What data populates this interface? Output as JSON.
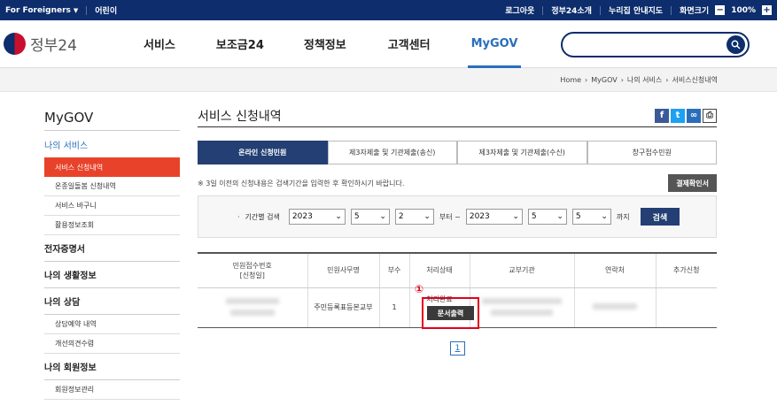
{
  "topbar": {
    "for_foreigners": "For Foreigners",
    "kids": "어린이",
    "logout": "로그아웃",
    "about": "정부24소개",
    "sitemap": "누리집 안내지도",
    "screen_size": "화면크기",
    "zoom_level": "100%"
  },
  "header": {
    "logo_text": "정부24",
    "nav": [
      "서비스",
      "보조금24",
      "정책정보",
      "고객센터",
      "MyGOV"
    ],
    "search_placeholder": ""
  },
  "breadcrumb": [
    "Home",
    "MyGOV",
    "나의 서비스",
    "서비스신청내역"
  ],
  "sidebar": {
    "title": "MyGOV",
    "my_services": "나의 서비스",
    "sub_items": [
      "서비스 신청내역",
      "온종일돌봄 신청내역",
      "서비스 바구니",
      "활용정보조회"
    ],
    "sections": [
      "전자증명서",
      "나의 생활정보",
      "나의 상담"
    ],
    "consult_items": [
      "상담예약 내역",
      "개선의견수렴"
    ],
    "member_section": "나의 회원정보",
    "member_items": [
      "회원정보관리"
    ]
  },
  "main": {
    "title": "서비스 신청내역",
    "tabs": [
      "온라인 신청민원",
      "제3자제출 및 기관제출(송신)",
      "제3자제출 및 기관제출(수신)",
      "창구접수민원"
    ],
    "notice": "※ 3일 이전의 신청내용은 검색기간을 입력한 후 확인하시기 바랍니다.",
    "receipt_button": "결제확인서",
    "filter": {
      "label": "기간별 검색",
      "from_year": "2023",
      "from_month": "5",
      "from_day": "2",
      "from_text": "부터 ~",
      "to_year": "2023",
      "to_month": "5",
      "to_day": "5",
      "to_text": "까지",
      "search_button": "검색"
    },
    "table": {
      "headers": [
        "민원접수번호\n[신청일]",
        "민원사무명",
        "부수",
        "처리상태",
        "교부기관",
        "연락처",
        "추가신청"
      ],
      "rows": [
        {
          "office_name": "주민등록표등본교부",
          "copies": "1",
          "status": "처리완료",
          "print_button": "문서출력"
        }
      ]
    },
    "annotation_number": "①",
    "pagination": [
      "1"
    ]
  }
}
